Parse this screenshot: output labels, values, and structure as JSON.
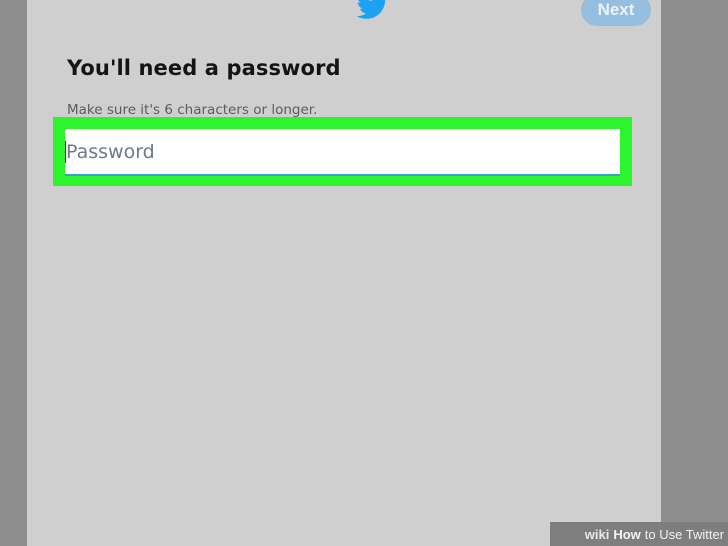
{
  "dialog": {
    "logo_icon": "twitter-bird-icon",
    "logo_color": "#1da1f2",
    "next_label": "Next",
    "title": "You'll need a password",
    "hint": "Make sure it's 6 characters or longer.",
    "password_field": {
      "placeholder": "Password",
      "value": ""
    },
    "highlight_color": "#2df52d",
    "accent_color": "#3b9cda"
  },
  "watermark": {
    "brand": "wiki",
    "bold": "How",
    "rest": "to Use Twitter"
  }
}
